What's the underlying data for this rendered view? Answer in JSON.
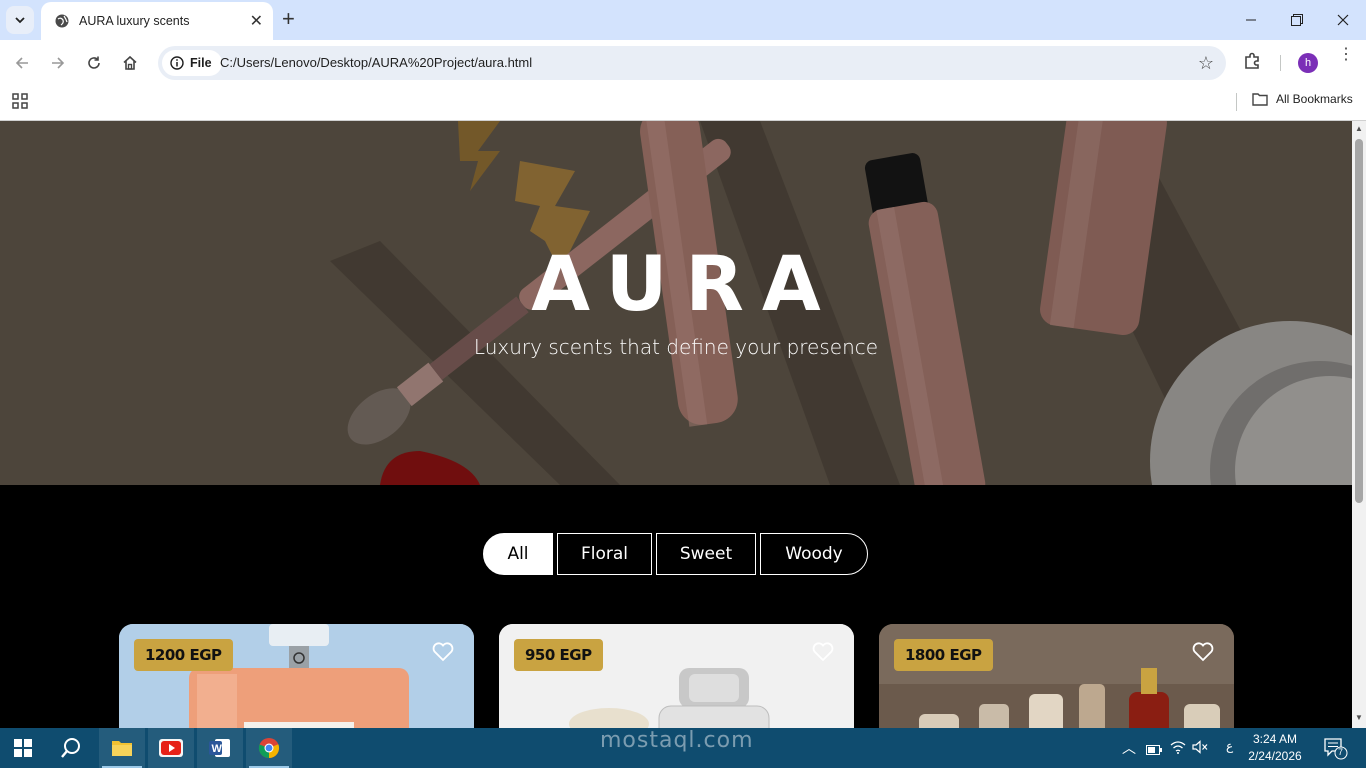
{
  "browser": {
    "tab_title": "AURA luxury scents",
    "file_chip_label": "File",
    "url": "C:/Users/Lenovo/Desktop/AURA%20Project/aura.html",
    "profile_initial": "h",
    "bookmarks_label": "All Bookmarks"
  },
  "hero": {
    "title": "AURA",
    "subtitle": "Luxury scents that define your presence"
  },
  "filters": [
    {
      "label": "All",
      "active": true
    },
    {
      "label": "Floral",
      "active": false
    },
    {
      "label": "Sweet",
      "active": false
    },
    {
      "label": "Woody",
      "active": false
    }
  ],
  "products": [
    {
      "price": "1200 EGP",
      "image": "orange perfume bottle on light blue background"
    },
    {
      "price": "950 EGP",
      "image": "clear perfume bottle on white background"
    },
    {
      "price": "1800 EGP",
      "image": "collection of perfume bottles"
    }
  ],
  "taskbar": {
    "time": "3:24 AM",
    "date": "2/24/2026",
    "lang": "ع",
    "notifications": "7",
    "watermark": "mostaql.com"
  },
  "colors": {
    "tab_strip": "#d3e3fd",
    "price_badge": "#c9a341",
    "taskbar": "#0f4c6f"
  }
}
